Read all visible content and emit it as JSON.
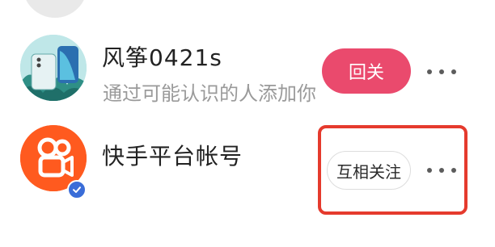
{
  "list": {
    "items": [
      {
        "name": "风筝0421s",
        "subtitle": "通过可能认识的人添加你",
        "action_label": "回关",
        "action_color": "#ea4a6d"
      },
      {
        "name": "快手平台帐号",
        "subtitle": "",
        "action_label": "互相关注",
        "verified": true
      }
    ]
  },
  "icons": {
    "more": "more-dots-icon",
    "verified": "verified-check-icon",
    "kuaishou": "kuaishou-camera-logo-icon"
  },
  "colors": {
    "highlight_border": "#e53a2d",
    "kuaishou_orange": "#ff5a1f",
    "verified_blue": "#3a6dd8"
  }
}
